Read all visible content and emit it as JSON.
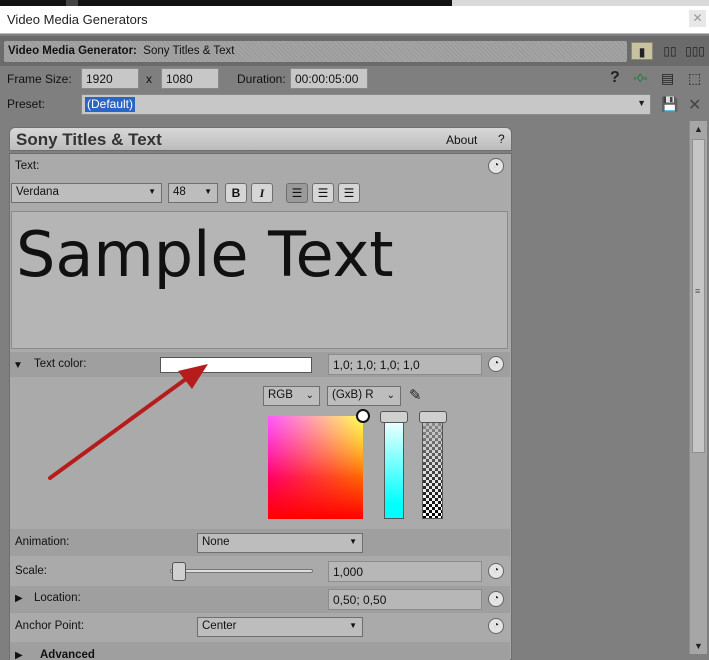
{
  "window": {
    "title": "Video Media Generators"
  },
  "header": {
    "label": "Video Media Generator:",
    "value": "Sony Titles & Text"
  },
  "frame": {
    "frame_size_label": "Frame Size:",
    "width": "1920",
    "x_label": "x",
    "height": "1080",
    "duration_label": "Duration:",
    "duration": "00:00:05:00"
  },
  "preset": {
    "label": "Preset:",
    "value": "(Default)"
  },
  "plugin": {
    "title": "Sony Titles & Text",
    "about": "About",
    "help": "?"
  },
  "text_section": {
    "label": "Text:",
    "font": "Verdana",
    "size": "48",
    "bold": "B",
    "italic": "I",
    "content": "Sample Text"
  },
  "text_color": {
    "label": "Text color:",
    "swatch": "#ffffff",
    "value": "1,0; 1,0; 1,0; 1,0",
    "mode": "RGB",
    "channel": "(GxB) R"
  },
  "animation": {
    "label": "Animation:",
    "value": "None"
  },
  "scale": {
    "label": "Scale:",
    "value": "1,000"
  },
  "location": {
    "label": "Location:",
    "value": "0,50; 0,50"
  },
  "anchor": {
    "label": "Anchor Point:",
    "value": "Center"
  },
  "advanced": {
    "label": "Advanced"
  },
  "colors": {
    "annotation_arrow": "#b71c1c",
    "selection": "#2a64c4"
  }
}
